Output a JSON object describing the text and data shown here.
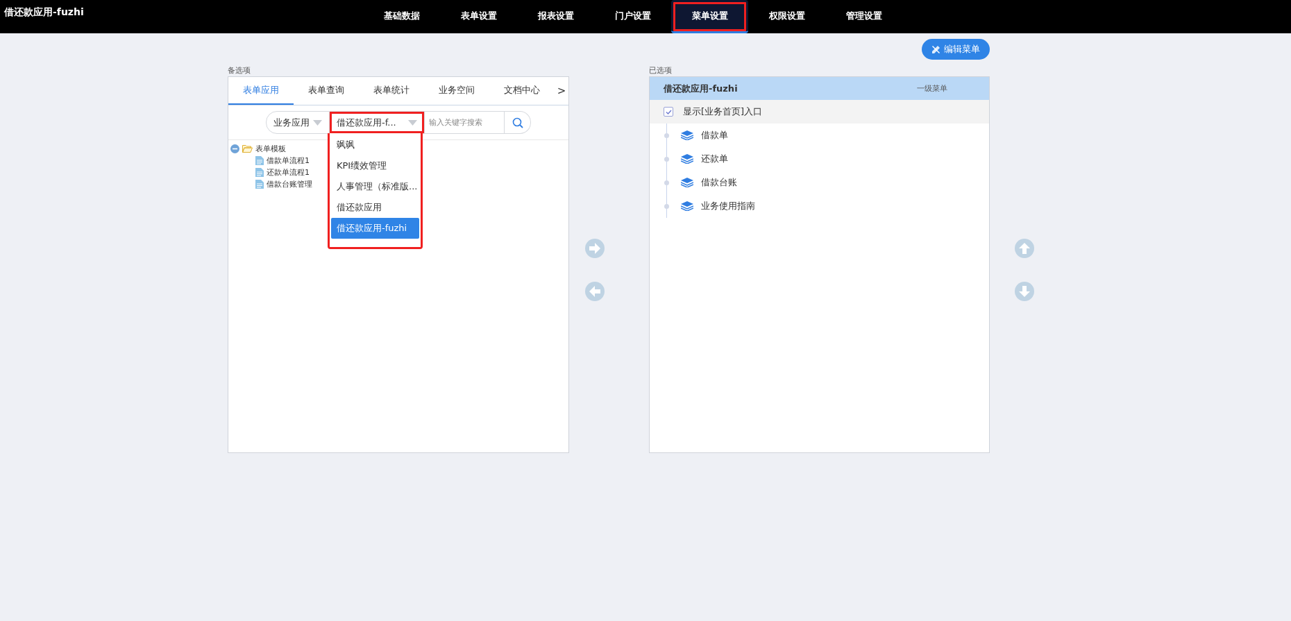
{
  "app_title": "借还款应用-fuzhi",
  "nav": [
    {
      "label": "基础数据",
      "selected": false,
      "highlighted": false
    },
    {
      "label": "表单设置",
      "selected": false,
      "highlighted": false
    },
    {
      "label": "报表设置",
      "selected": false,
      "highlighted": false
    },
    {
      "label": "门户设置",
      "selected": false,
      "highlighted": false
    },
    {
      "label": "菜单设置",
      "selected": true,
      "highlighted": true
    },
    {
      "label": "权限设置",
      "selected": false,
      "highlighted": false
    },
    {
      "label": "管理设置",
      "selected": false,
      "highlighted": false
    }
  ],
  "available": {
    "label": "备选项",
    "tabs": [
      {
        "label": "表单应用",
        "selected": true
      },
      {
        "label": "表单查询",
        "selected": false
      },
      {
        "label": "表单统计",
        "selected": false
      },
      {
        "label": "业务空间",
        "selected": false
      },
      {
        "label": "文档中心",
        "selected": false
      }
    ],
    "more": ">",
    "filters": [
      {
        "value": "业务应用",
        "open": false,
        "highlighted": false
      },
      {
        "value": "借还款应用-f...",
        "open": true,
        "highlighted": true
      }
    ],
    "search": {
      "placeholder": "输入关键字搜索"
    },
    "dropdown_options": [
      {
        "label": "飒飒",
        "selected": false
      },
      {
        "label": "KPI绩效管理",
        "selected": false
      },
      {
        "label": "人事管理（标准版...",
        "selected": false
      },
      {
        "label": "借还款应用",
        "selected": false
      },
      {
        "label": "借还款应用-fuzhi",
        "selected": true
      }
    ],
    "tree": [
      {
        "label": "表单模板",
        "expanded": true,
        "children": [
          {
            "label": "借款单流程1"
          },
          {
            "label": "还款单流程1"
          },
          {
            "label": "借款台账管理"
          }
        ]
      }
    ]
  },
  "selected_panel": {
    "label": "已选项",
    "title": "借还款应用-fuzhi",
    "menu_level": "一级菜单",
    "home_entry": {
      "label": "显示[业务首页]入口",
      "checked": true
    },
    "items": [
      {
        "label": "借款单"
      },
      {
        "label": "还款单"
      },
      {
        "label": "借款台账"
      },
      {
        "label": "业务使用指南"
      }
    ]
  },
  "edit_button": "编辑菜单"
}
